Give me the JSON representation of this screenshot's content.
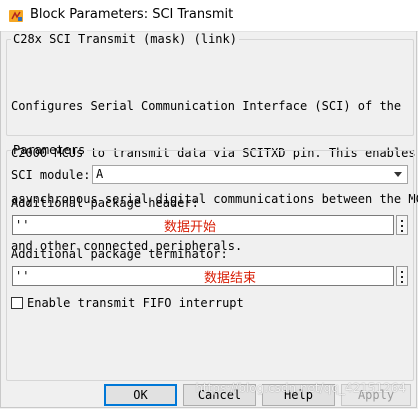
{
  "window": {
    "title": "Block Parameters: SCI Transmit",
    "icon": "simulink-block-icon"
  },
  "description": {
    "heading": "C28x SCI Transmit (mask) (link)",
    "lines": [
      "Configures Serial Communication Interface (SCI) of the",
      "C2000 MCUs to transmit data via SCITXD pin. This enables",
      "asynchronous serial digital communications between the MCU",
      "and other connected peripherals."
    ]
  },
  "parameters": {
    "heading": "Parameters",
    "sci_module_label": "SCI module:",
    "sci_module_value": "A",
    "header_label": "Additional package header:",
    "header_value": "''",
    "header_annotation": "数据开始",
    "terminator_label": "Additional package terminator:",
    "terminator_value": "''",
    "terminator_annotation": "数据结束",
    "fifo_label": "Enable transmit FIFO interrupt",
    "fifo_checked": false
  },
  "buttons": {
    "ok": "OK",
    "cancel": "Cancel",
    "help": "Help",
    "apply": "Apply"
  },
  "watermark": "https://blog.csdn.net/qq_42151264",
  "colors": {
    "annotation": "#d81e06",
    "default_button_border": "#0078d7"
  }
}
